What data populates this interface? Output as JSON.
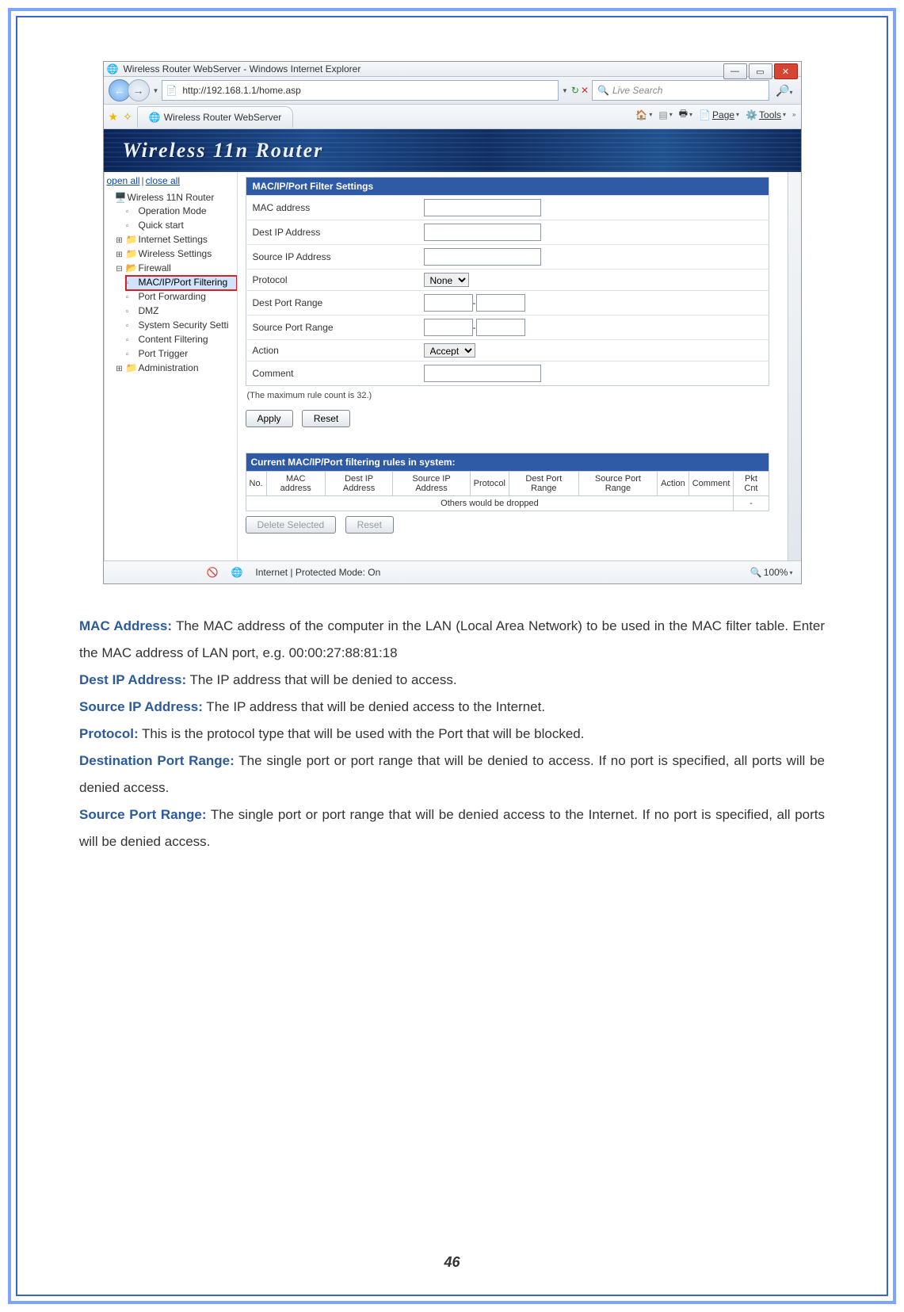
{
  "browser": {
    "window_title": "Wireless Router WebServer - Windows Internet Explorer",
    "url": "http://192.168.1.1/home.asp",
    "search_placeholder": "Live Search",
    "tab_title": "Wireless Router WebServer",
    "toolbar": {
      "page": "Page",
      "tools": "Tools"
    },
    "status": {
      "mode": "Internet | Protected Mode: On",
      "zoom": "100%"
    }
  },
  "banner": {
    "title": "Wireless 11n Router"
  },
  "tree": {
    "open_all": "open all",
    "close_all": "close all",
    "root": "Wireless 11N Router",
    "operation_mode": "Operation Mode",
    "quick_start": "Quick start",
    "internet_settings": "Internet Settings",
    "wireless_settings": "Wireless Settings",
    "firewall": "Firewall",
    "mac_ip_port_filtering": "MAC/IP/Port Filtering",
    "port_forwarding": "Port Forwarding",
    "dmz": "DMZ",
    "system_security": "System Security Setti",
    "content_filtering": "Content Filtering",
    "port_trigger": "Port Trigger",
    "administration": "Administration"
  },
  "form": {
    "header": "MAC/IP/Port Filter Settings",
    "mac_address": "MAC address",
    "dest_ip": "Dest IP Address",
    "source_ip": "Source IP Address",
    "protocol": "Protocol",
    "protocol_value": "None",
    "dest_port_range": "Dest Port Range",
    "source_port_range": "Source Port Range",
    "action": "Action",
    "action_value": "Accept",
    "comment": "Comment",
    "note": "(The maximum rule count is 32.)",
    "apply": "Apply",
    "reset": "Reset"
  },
  "rules": {
    "header": "Current MAC/IP/Port filtering rules in system:",
    "cols": {
      "no": "No.",
      "mac": "MAC address",
      "dest_ip": "Dest IP Address",
      "src_ip": "Source IP Address",
      "protocol": "Protocol",
      "dest_port": "Dest Port Range",
      "src_port": "Source Port Range",
      "action": "Action",
      "comment": "Comment",
      "pkt": "Pkt Cnt"
    },
    "others_row": "Others would be dropped",
    "others_dash": "-",
    "delete_selected": "Delete Selected",
    "reset": "Reset"
  },
  "desc": {
    "t1": "MAC Address:",
    "d1a": " The MAC address of the computer in the LAN (Local Area Network) to be used in the MAC filter table. Enter the MAC address of LAN port, e.g. 00:00:27:88:81:18",
    "t2": "Dest IP Address:",
    "d2": " The IP address that will be denied to access.",
    "t3": "Source IP Address:",
    "d3": " The IP address that will be denied access to the Internet.",
    "t4": "Protocol:",
    "d4": " This is the protocol type that will be used with the Port that will be blocked.",
    "t5": "Destination Port Range:",
    "d5": " The single port or port range that will be denied to access. If no port is specified, all ports will be denied access.",
    "t6": "Source Port Range:",
    "d6": " The single port or port range that will be denied access to the Internet. If no port is specified, all ports will be denied access."
  },
  "page_number": "46"
}
